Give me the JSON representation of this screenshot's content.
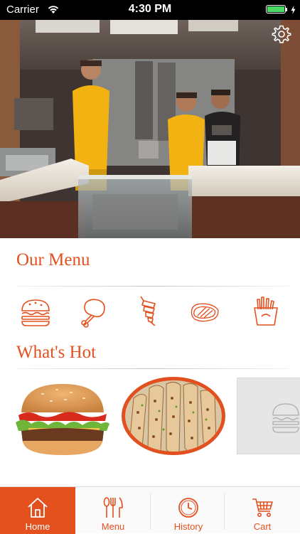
{
  "status_bar": {
    "carrier": "Carrier",
    "time": "4:30 PM",
    "battery_level": 1.0
  },
  "hero": {
    "settings_icon": "gear-icon"
  },
  "menu_section": {
    "title": "Our Menu",
    "categories": [
      {
        "icon": "burger-icon"
      },
      {
        "icon": "chicken-leg-icon"
      },
      {
        "icon": "kebab-icon"
      },
      {
        "icon": "steak-icon"
      },
      {
        "icon": "fries-icon"
      }
    ]
  },
  "hot_section": {
    "title": "What's Hot",
    "items": [
      {
        "icon": "burger-photo"
      },
      {
        "icon": "kebab-rolls-photo"
      },
      {
        "icon": "burger-placeholder-icon"
      }
    ]
  },
  "tab_bar": {
    "tabs": [
      {
        "label": "Home",
        "icon": "home-icon",
        "active": true
      },
      {
        "label": "Menu",
        "icon": "utensils-icon",
        "active": false
      },
      {
        "label": "History",
        "icon": "clock-icon",
        "active": false
      },
      {
        "label": "Cart",
        "icon": "cart-icon",
        "active": false
      }
    ]
  },
  "colors": {
    "accent": "#e4501e",
    "status_bar_bg": "#000000",
    "tab_active_bg": "#e4501e"
  }
}
